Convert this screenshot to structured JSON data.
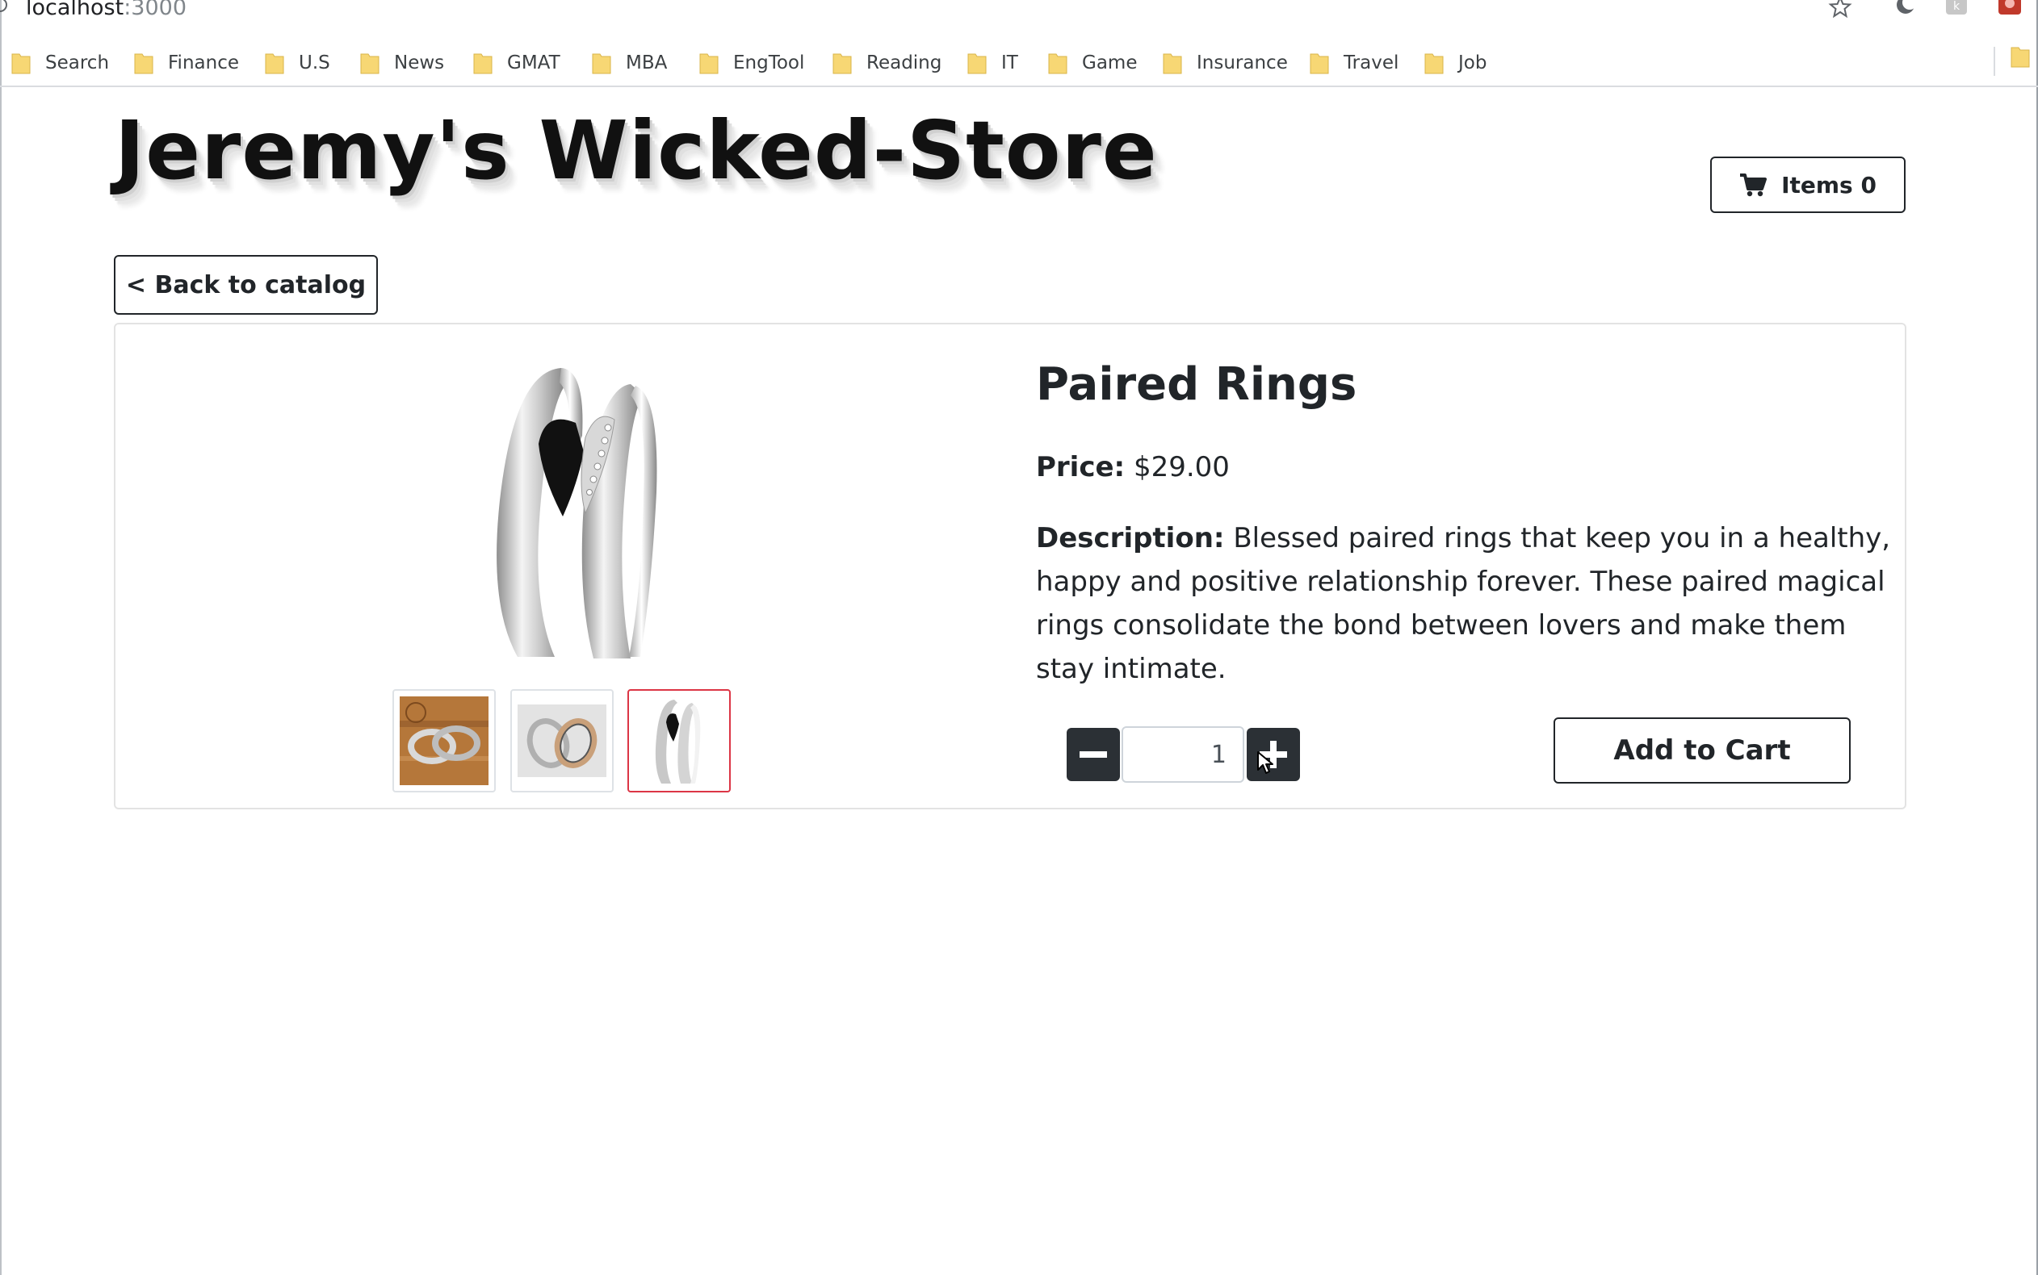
{
  "browser": {
    "url_host": "localhost",
    "url_port": ":3000",
    "bookmarks": [
      "Search",
      "Finance",
      "U.S",
      "News",
      "GMAT",
      "MBA",
      "EngTool",
      "Reading",
      "IT",
      "Game",
      "Insurance",
      "Travel",
      "Job"
    ],
    "folder_color": "#f7d774"
  },
  "store": {
    "title": "Jeremy's Wicked-Store",
    "cart_label": "Items 0",
    "back_label": "< Back to catalog"
  },
  "product": {
    "name": "Paired Rings",
    "price_label": "Price:",
    "price": "$29.00",
    "description_label": "Description:",
    "description": "Blessed paired rings that keep you in a healthy, happy and positive relationship forever. These paired magical rings consolidate the bond between lovers and make them stay intimate.",
    "quantity": "1",
    "add_to_cart_label": "Add to Cart",
    "active_thumbnail": 3,
    "active_color": "#dc3545"
  }
}
